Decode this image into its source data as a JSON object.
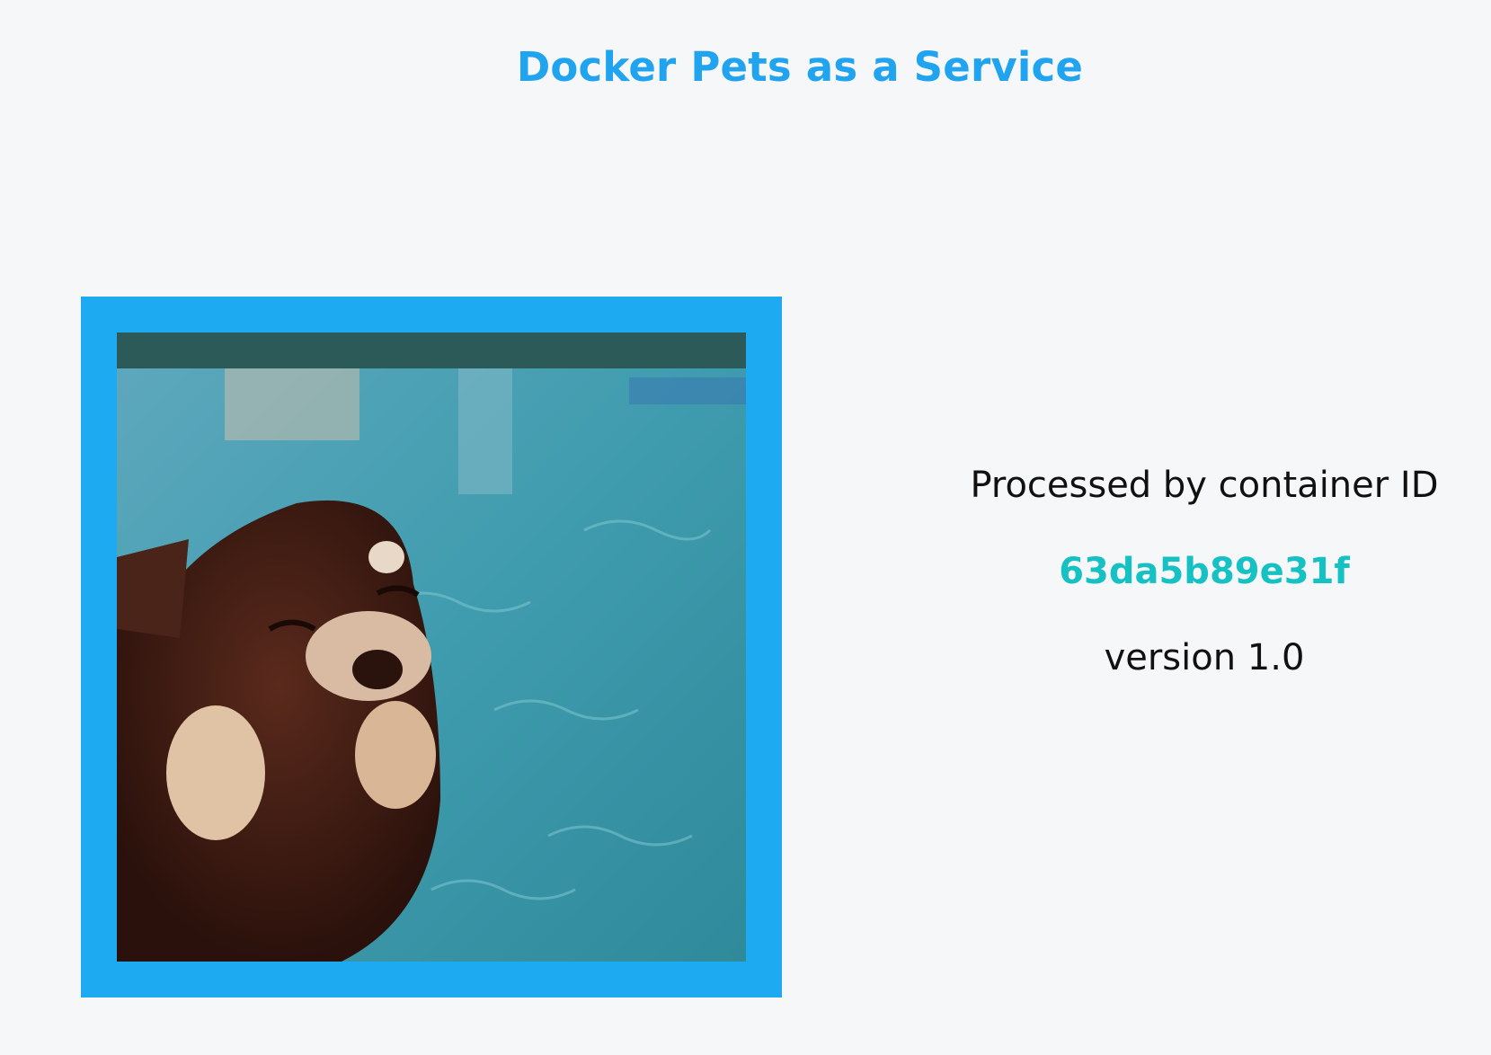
{
  "header": {
    "title": "Docker Pets as a Service"
  },
  "pet": {
    "description_icon": "pet-photo",
    "frame_color": "#1eaaf1"
  },
  "info": {
    "processed_label": "Processed by container ID",
    "container_id": "63da5b89e31f",
    "version": "version 1.0"
  },
  "colors": {
    "title": "#21a4f0",
    "container_id": "#16c1c4",
    "background": "#f6f7f8"
  }
}
